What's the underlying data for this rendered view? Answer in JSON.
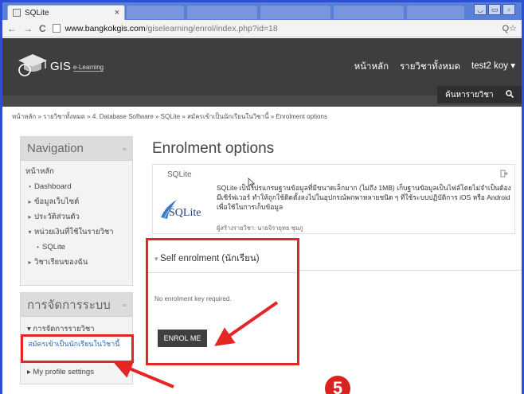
{
  "browser": {
    "tab_title": "SQLite",
    "tab_close": "×",
    "url_host": "www.bangkokgis.com",
    "url_path": "/giselearning/enrol/index.php?id=18",
    "nav_back": "←",
    "nav_forward": "→",
    "nav_reload": "C",
    "zoom_icon": "Q☆"
  },
  "header": {
    "logo_name": "GIS",
    "logo_sub": "e-Learning",
    "nav": [
      "หน้าหลัก",
      "รายวิชาทั้งหมด",
      "test2 koy ▾"
    ],
    "search_label": "ค้นหารายวิชา",
    "search_icon": "🔍"
  },
  "breadcrumb": "หน้าหลัก » รายวิชาทั้งหมด » 4. Database Software » SQLite » สมัครเข้าเป็นนักเรียนในวิชานี้ » Enrolment options",
  "navigation": {
    "title": "Navigation",
    "dock": "▫▫",
    "items": [
      {
        "bullet": "",
        "label": "หน้าหลัก"
      },
      {
        "bullet": "•",
        "label": "Dashboard"
      },
      {
        "bullet": "▸",
        "label": "ข้อมูลเว็บไซต์"
      },
      {
        "bullet": "▸",
        "label": "ประวัติส่วนตัว"
      },
      {
        "bullet": "▾",
        "label": "หน่วยเงินที่ใช้ในรายวิชา"
      },
      {
        "bullet": "•",
        "label": "SQLite"
      },
      {
        "bullet": "▸",
        "label": "วิชาเรียนของฉัน"
      }
    ]
  },
  "admin": {
    "title": "การจัดการระบบ",
    "dock": "▫▫",
    "course_admin": "▾ การจัดการรายวิชา",
    "enrol_link": "สมัครเข้าเป็นนักเรียนในวิชานี้",
    "profile": "▸ My profile settings"
  },
  "main": {
    "title": "Enrolment options",
    "course_name": "SQLite",
    "course_summary": "SQLite เป็นโปรแกรมฐานข้อมูลที่มีขนาดเล็กมาก (ไม่ถึง 1MB) เก็บฐานข้อมูลเป็นไฟล์โดยไม่จำเป็นต้องมีเซิร์ฟเวอร์ ทำให้ถูกใช้ติดตั้งลงไปในอุปกรณ์พกพาหลายชนิด ๆ ที่ใช้ระบบปฏิบัติการ iOS หรือ Android เพื่อใช้ในการเก็บข้อมูล",
    "course_teacher": "ผู้สร้างรายวิชา: นายจิรายุทธ ชุมภู",
    "sqlite_logo": "SQLite",
    "enrol_section": "Self enrolment (นักเรียน)",
    "enrol_note": "No enrolment key required.",
    "enrol_button": "ENROL ME"
  },
  "step_number": "5",
  "colors": {
    "highlight": "#e52424",
    "header": "#3e3e3e",
    "chrome": "#2b4fd8"
  }
}
